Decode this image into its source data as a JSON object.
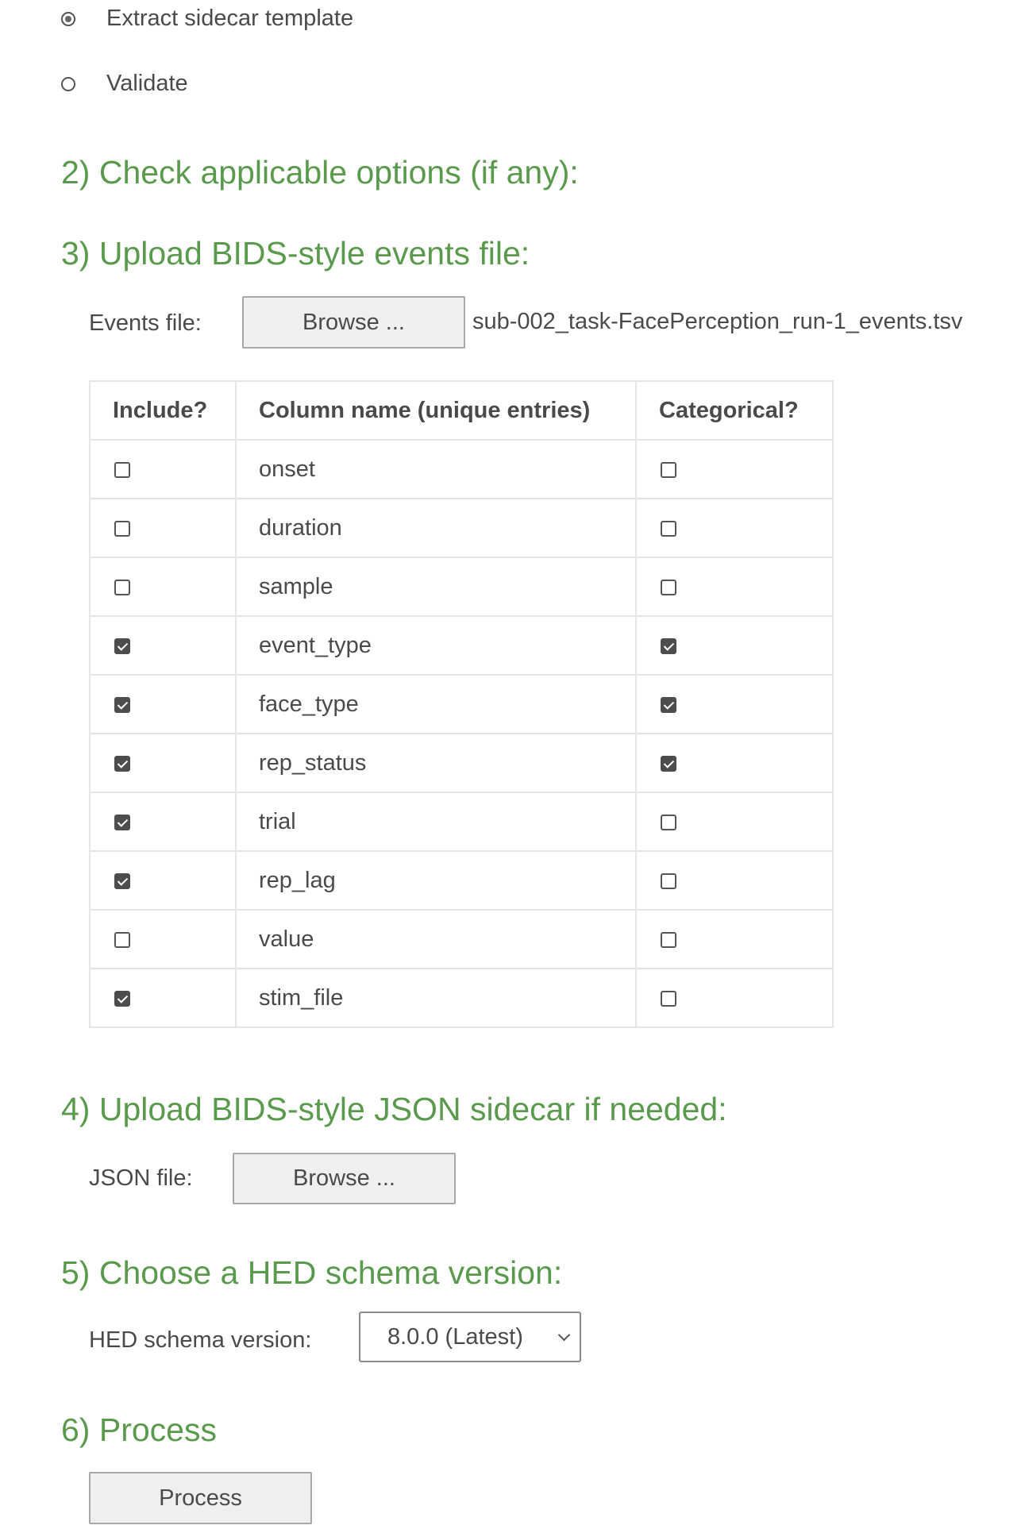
{
  "step1": {
    "options": [
      {
        "label": "Extract sidecar template",
        "selected": true
      },
      {
        "label": "Validate",
        "selected": false
      }
    ]
  },
  "step2": {
    "heading": "2) Check applicable options (if any):"
  },
  "step3": {
    "heading": "3) Upload BIDS-style events file:",
    "file_label": "Events file:",
    "browse_label": "Browse ...",
    "file_name": "sub-002_task-FacePerception_run-1_events.tsv",
    "table": {
      "headers": [
        "Include?",
        "Column name (unique entries)",
        "Categorical?"
      ],
      "rows": [
        {
          "name": "onset",
          "include": false,
          "categorical": false
        },
        {
          "name": "duration",
          "include": false,
          "categorical": false
        },
        {
          "name": "sample",
          "include": false,
          "categorical": false
        },
        {
          "name": "event_type",
          "include": true,
          "categorical": true
        },
        {
          "name": "face_type",
          "include": true,
          "categorical": true
        },
        {
          "name": "rep_status",
          "include": true,
          "categorical": true
        },
        {
          "name": "trial",
          "include": true,
          "categorical": false
        },
        {
          "name": "rep_lag",
          "include": true,
          "categorical": false
        },
        {
          "name": "value",
          "include": false,
          "categorical": false
        },
        {
          "name": "stim_file",
          "include": true,
          "categorical": false
        }
      ]
    }
  },
  "step4": {
    "heading": "4) Upload BIDS-style JSON sidecar if needed:",
    "file_label": "JSON file:",
    "browse_label": "Browse ..."
  },
  "step5": {
    "heading": "5) Choose a HED schema version:",
    "label": "HED schema version:",
    "selected_version": "8.0.0 (Latest)"
  },
  "step6": {
    "heading": "6) Process",
    "button_label": "Process"
  }
}
